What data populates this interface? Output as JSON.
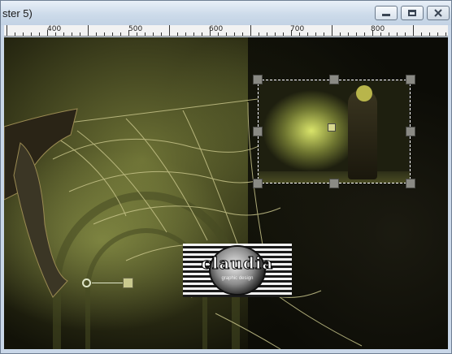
{
  "window": {
    "title": "ster 5)",
    "buttons": {
      "minimize": "minimize-icon",
      "maximize": "maximize-icon",
      "close": "close-icon"
    }
  },
  "ruler": {
    "labels": [
      "400",
      "500",
      "600",
      "700",
      "800"
    ]
  },
  "logo": {
    "name": "claudia",
    "subtitle": "graphic design"
  },
  "colors": {
    "titlebar": "#c9d7e8",
    "canvas_dark": "#121208",
    "canvas_olive": "#6e7336",
    "selection_handle": "#8a8a84",
    "web_strand": "#c7c48a"
  }
}
